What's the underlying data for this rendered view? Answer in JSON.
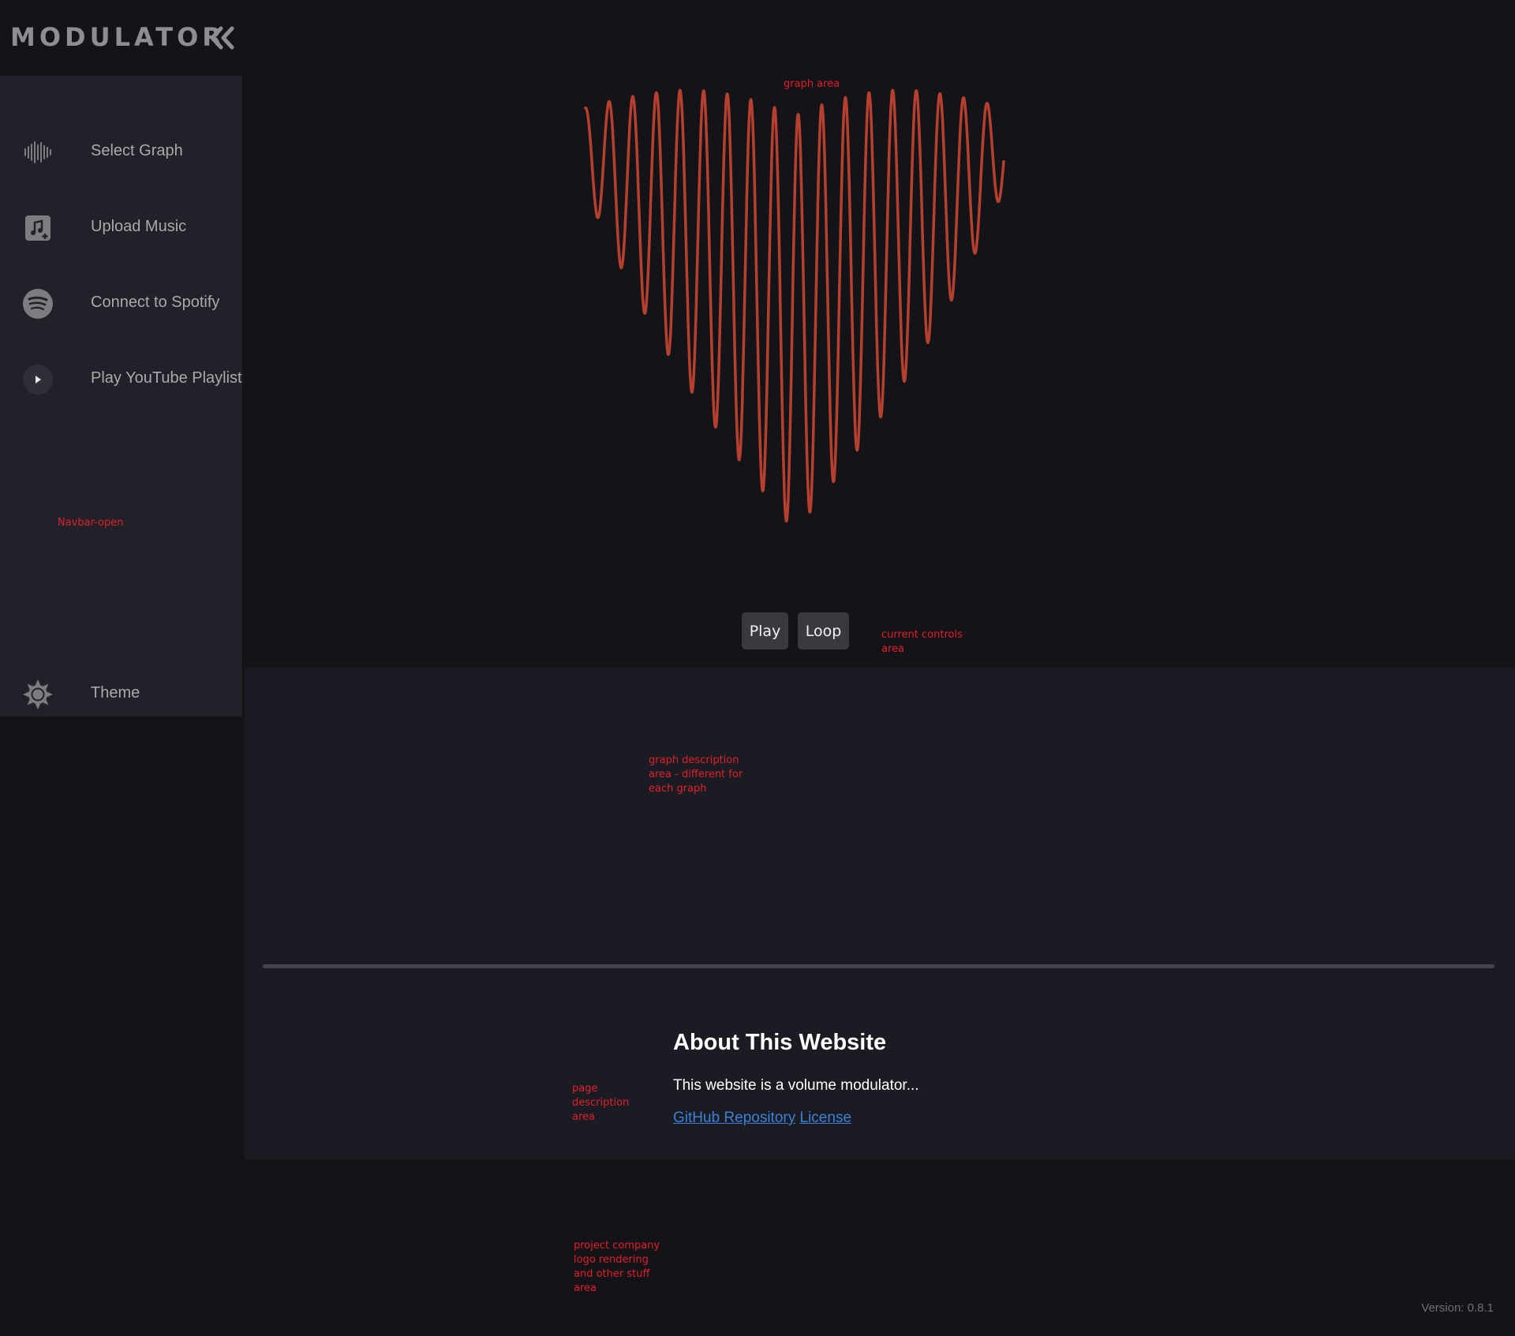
{
  "app": {
    "logo": "MODULATOR"
  },
  "sidebar": {
    "items": [
      {
        "label": "Select Graph",
        "icon": "waveform-icon"
      },
      {
        "label": "Upload Music",
        "icon": "music-upload-icon"
      },
      {
        "label": "Connect to Spotify",
        "icon": "spotify-icon"
      },
      {
        "label": "Play YouTube Playlist",
        "icon": "play-circle-icon"
      }
    ],
    "theme": {
      "label": "Theme",
      "icon": "sun-gear-icon"
    }
  },
  "annotations": {
    "navbar": "Navbar-open",
    "graph": "graph area",
    "controls": "current controls area",
    "description": "graph description area - different for each graph",
    "page_description": "page description area",
    "footer": "project company logo rendering and other stuff area"
  },
  "controls": {
    "play": "Play",
    "loop": "Loop"
  },
  "about": {
    "title": "About This Website",
    "text": "This website is a volume modulator...",
    "links": [
      "GitHub Repository",
      "License"
    ]
  },
  "footer": {
    "version": "Version: 0.8.1"
  },
  "colors": {
    "background": "#131318",
    "sidebar": "#212129",
    "graph_line": "#b5402f",
    "annotation": "#e0212b",
    "link": "#3b82d6"
  }
}
